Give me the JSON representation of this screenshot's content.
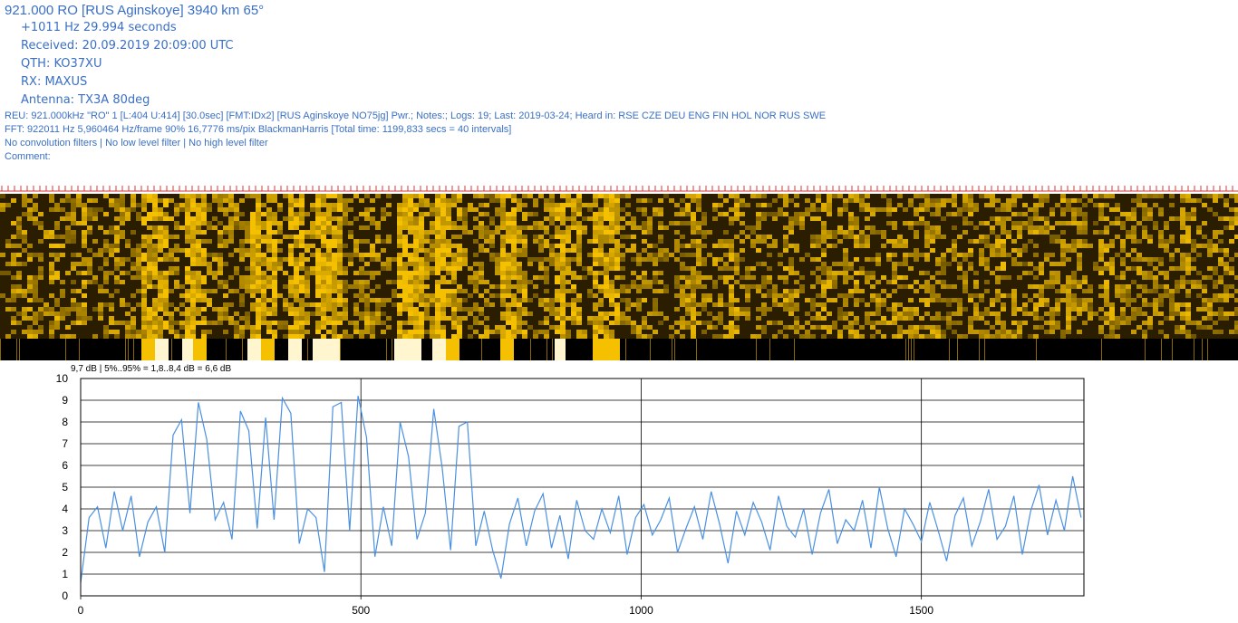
{
  "header": {
    "title": "921.000 RO [RUS Aginskoye] 3940 km 65°",
    "offset_line": "+1011 Hz 29.994 seconds",
    "received": "Received: 20.09.2019 20:09:00 UTC",
    "qth": "QTH: KO37XU",
    "rx": "RX: MAXUS",
    "antenna": "Antenna: TX3A 80deg"
  },
  "info": {
    "reu": "REU: 921.000kHz  \"RO\" 1 [L:404 U:414] [30.0sec] [FMT:IDx2] [RUS  Aginskoye NO75jg] Pwr.; Notes:; Logs:  19; Last: 2019-03-24; Heard in: RSE CZE DEU ENG FIN HOL NOR RUS SWE",
    "fft": "FFT: 922011 Hz 5,960464 Hz/frame 90% 16,7776 ms/pix BlackmanHarris [Total time: 1199,833 secs = 40 intervals]",
    "filters": "No convolution filters | No low level filter | No high level filter",
    "comment": "Comment:"
  },
  "colors": {
    "text": "#3a6fc4",
    "series": "#4a90e2",
    "spectrogram_bright": "#f5c000",
    "spectrogram_dark": "#000000",
    "ruler": "#d23a3a"
  },
  "chart_data": {
    "type": "line",
    "title": "9,7 dB | 5%..95% = 1,8..8,4 dB = 6,6 dB",
    "xlabel": "",
    "ylabel": "",
    "xlim": [
      0,
      1790
    ],
    "ylim": [
      0,
      10
    ],
    "xticks": [
      "0",
      "500",
      "1000",
      "1500"
    ],
    "yticks": [
      "0",
      "1",
      "2",
      "3",
      "4",
      "5",
      "6",
      "7",
      "8",
      "9",
      "10"
    ],
    "grid": true,
    "series": [
      {
        "name": "",
        "x": [
          0,
          15,
          30,
          45,
          60,
          75,
          90,
          105,
          120,
          135,
          150,
          165,
          180,
          195,
          210,
          225,
          240,
          255,
          270,
          285,
          300,
          315,
          330,
          345,
          360,
          375,
          390,
          405,
          420,
          435,
          450,
          465,
          480,
          495,
          510,
          525,
          540,
          555,
          570,
          585,
          600,
          615,
          630,
          645,
          660,
          675,
          690,
          705,
          720,
          735,
          750,
          765,
          780,
          795,
          810,
          825,
          840,
          855,
          870,
          885,
          900,
          915,
          930,
          945,
          960,
          975,
          990,
          1005,
          1020,
          1035,
          1050,
          1065,
          1080,
          1095,
          1110,
          1125,
          1140,
          1155,
          1170,
          1185,
          1200,
          1215,
          1230,
          1245,
          1260,
          1275,
          1290,
          1305,
          1320,
          1335,
          1350,
          1365,
          1380,
          1395,
          1410,
          1425,
          1440,
          1455,
          1470,
          1485,
          1500,
          1515,
          1530,
          1545,
          1560,
          1575,
          1590,
          1605,
          1620,
          1635,
          1650,
          1665,
          1680,
          1695,
          1710,
          1725,
          1740,
          1755,
          1770,
          1785
        ],
        "y": [
          0.6,
          3.6,
          4.1,
          2.2,
          4.8,
          3.0,
          4.6,
          1.8,
          3.4,
          4.1,
          2.0,
          7.4,
          8.1,
          3.8,
          8.9,
          7.2,
          3.5,
          4.3,
          2.6,
          8.5,
          7.6,
          3.1,
          8.2,
          3.5,
          9.1,
          8.4,
          2.4,
          4.0,
          3.6,
          1.1,
          8.7,
          8.9,
          3.0,
          9.2,
          7.3,
          1.8,
          4.1,
          2.3,
          8.0,
          6.4,
          2.6,
          3.8,
          8.6,
          5.9,
          2.1,
          7.8,
          8.0,
          2.3,
          3.9,
          2.1,
          0.8,
          3.3,
          4.5,
          2.3,
          3.9,
          4.7,
          2.2,
          3.7,
          1.7,
          4.4,
          3.0,
          2.6,
          4.0,
          2.9,
          4.6,
          1.9,
          3.6,
          4.2,
          2.8,
          3.5,
          4.5,
          2.0,
          3.1,
          4.1,
          2.6,
          4.8,
          3.3,
          1.5,
          3.9,
          2.8,
          4.3,
          3.4,
          2.1,
          4.6,
          3.2,
          2.7,
          4.0,
          1.9,
          3.8,
          4.9,
          2.4,
          3.5,
          3.0,
          4.4,
          2.2,
          5.0,
          3.1,
          1.8,
          4.0,
          3.3,
          2.5,
          4.3,
          3.0,
          1.6,
          3.7,
          4.5,
          2.3,
          3.4,
          4.9,
          2.6,
          3.2,
          4.6,
          1.9,
          3.9,
          5.1,
          2.8,
          4.4,
          3.0,
          5.5,
          3.6
        ]
      }
    ]
  }
}
